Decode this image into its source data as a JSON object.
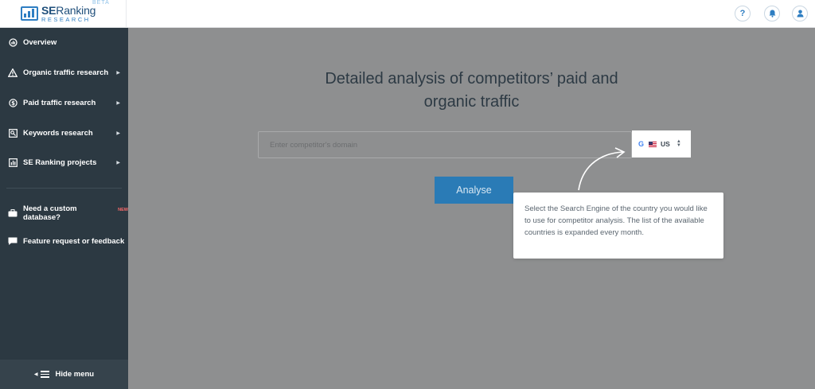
{
  "header": {
    "logo": {
      "brand_prefix": "SE",
      "brand_suffix": "Ranking",
      "sub": "RESEARCH",
      "beta": "BETA"
    },
    "help_icon": "question-icon",
    "notifications_icon": "bell-icon",
    "profile_icon": "user-icon",
    "help_glyph": "?",
    "accent_color": "#2e7ec2"
  },
  "sidebar": {
    "items": [
      {
        "label": "Overview",
        "icon": "overview-icon"
      },
      {
        "label": "Organic traffic research",
        "icon": "warning-triangle-icon",
        "has_arrow": true
      },
      {
        "label": "Paid traffic research",
        "icon": "dollar-icon",
        "has_arrow": true
      },
      {
        "label": "Keywords research",
        "icon": "keywords-icon",
        "has_arrow": true
      },
      {
        "label": "SE Ranking projects",
        "icon": "bar-chart-icon",
        "has_arrow": true
      }
    ],
    "extras": [
      {
        "label": "Need a custom database?",
        "badge": "NEW",
        "icon": "briefcase-icon"
      },
      {
        "label": "Feature request or feedback",
        "icon": "chat-icon"
      }
    ],
    "hide_menu": "Hide menu",
    "background": "#2c3942"
  },
  "main": {
    "headline_line1": "Detailed analysis of competitors’ paid and",
    "headline_line2": "organic traffic",
    "search": {
      "placeholder": "Enter competitor's domain",
      "value": ""
    },
    "country": {
      "engine": "G",
      "code": "US"
    },
    "analyse_label": "Analyse",
    "analyse_color": "#2a7bb6"
  },
  "tooltip": {
    "text": "Select the Search Engine of the country you would like to use for competitor analysis. The list of the available countries is expanded every month."
  }
}
